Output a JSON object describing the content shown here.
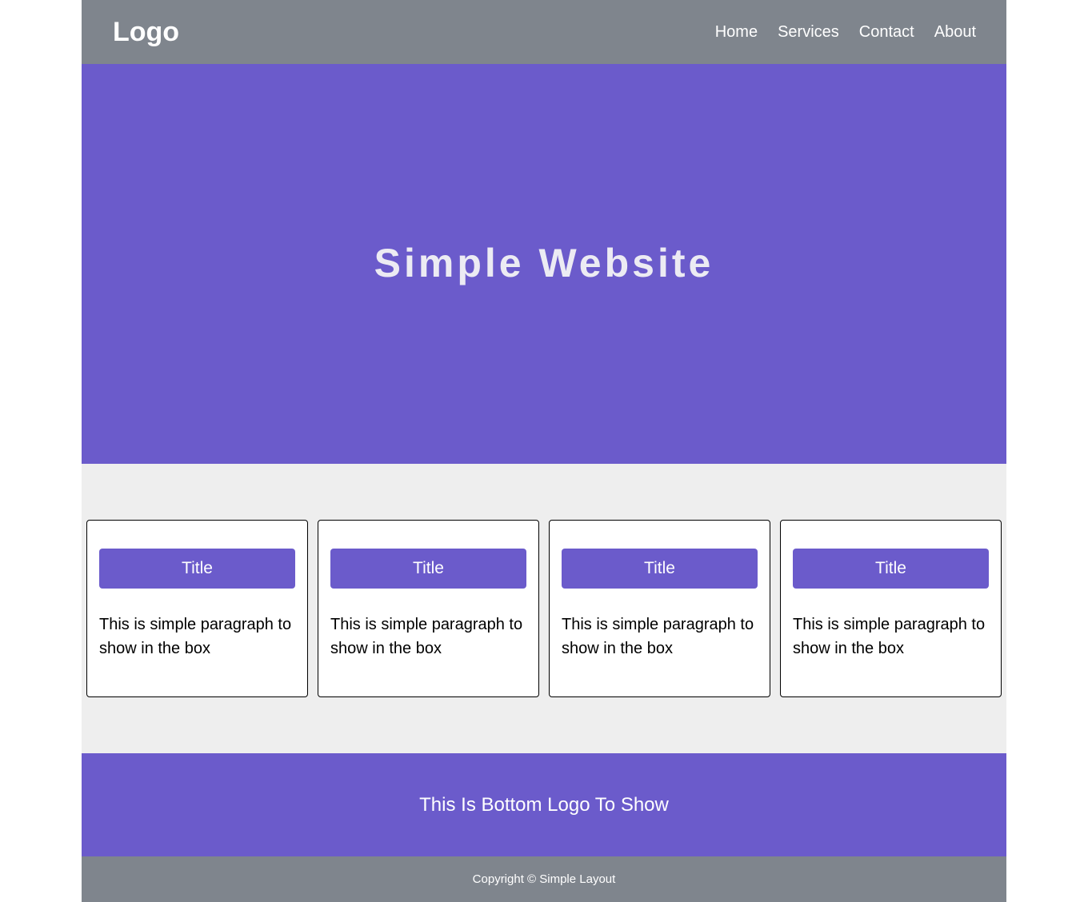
{
  "header": {
    "logo": "Logo",
    "nav": [
      {
        "label": "Home"
      },
      {
        "label": "Services"
      },
      {
        "label": "Contact"
      },
      {
        "label": "About"
      }
    ]
  },
  "hero": {
    "title": "Simple Website"
  },
  "cards": [
    {
      "title": "Title",
      "text": "This is simple paragraph to show in the box"
    },
    {
      "title": "Title",
      "text": "This is simple paragraph to show in the box"
    },
    {
      "title": "Title",
      "text": "This is simple paragraph to show in the box"
    },
    {
      "title": "Title",
      "text": "This is simple paragraph to show in the box"
    }
  ],
  "bottom_logo": {
    "text": "This Is Bottom Logo To Show"
  },
  "footer": {
    "copyright": "Copyright © Simple Layout"
  },
  "colors": {
    "header_bg": "#7f858d",
    "accent": "#6b5bcb",
    "features_bg": "#eeeeee"
  }
}
